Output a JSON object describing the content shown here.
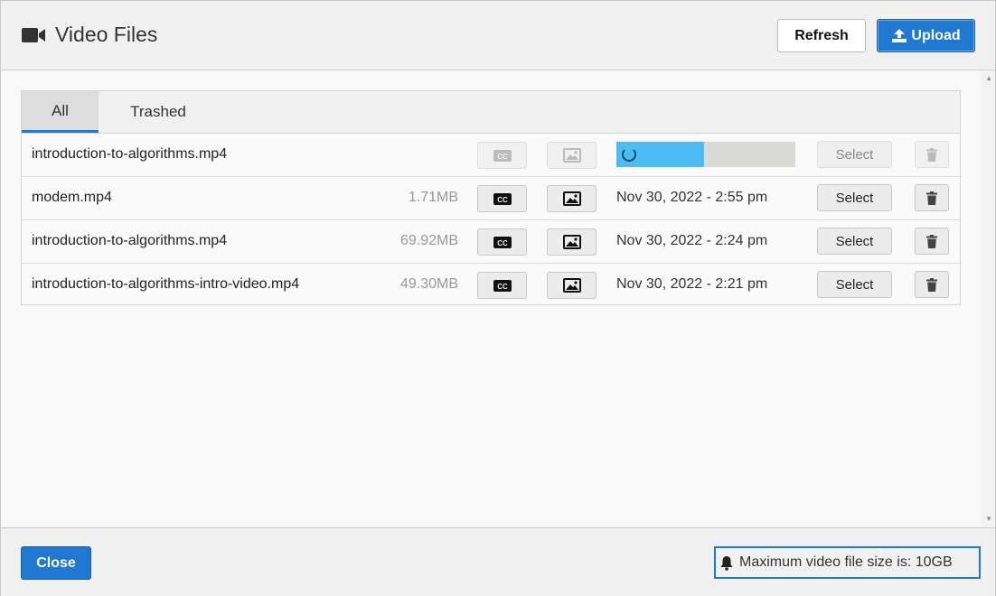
{
  "header": {
    "title": "Video Files",
    "refresh_label": "Refresh",
    "upload_label": "Upload"
  },
  "tabs": [
    {
      "label": "All",
      "active": true
    },
    {
      "label": "Trashed",
      "active": false
    }
  ],
  "files": [
    {
      "name": "introduction-to-algorithms.mp4",
      "size": "",
      "date": "",
      "uploading": true,
      "upload_progress": 0.49,
      "select_label": "Select"
    },
    {
      "name": "modem.mp4",
      "size": "1.71MB",
      "date": "Nov 30, 2022 - 2:55 pm",
      "select_label": "Select"
    },
    {
      "name": "introduction-to-algorithms.mp4",
      "size": "69.92MB",
      "date": "Nov 30, 2022 - 2:24 pm",
      "select_label": "Select"
    },
    {
      "name": "introduction-to-algorithms-intro-video.mp4",
      "size": "49.30MB",
      "date": "Nov 30, 2022 - 2:21 pm",
      "select_label": "Select"
    }
  ],
  "icons": {
    "title": "video-camera-icon",
    "upload": "upload-icon",
    "cc": "closed-caption-icon",
    "thumbnail": "image-icon",
    "trash": "trash-icon",
    "notice": "bell-icon"
  },
  "colors": {
    "primary": "#1f78d1",
    "progress": "#4dbdf1"
  },
  "footer": {
    "close_label": "Close",
    "notice": "Maximum video file size is: 10GB"
  }
}
